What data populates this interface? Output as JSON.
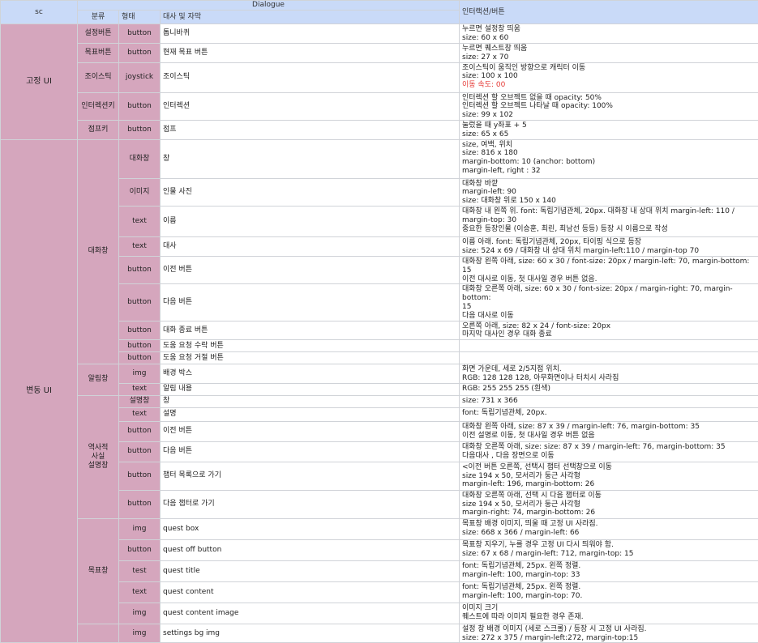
{
  "header": {
    "sc": "sc",
    "dialogue": "Dialogue",
    "interaction": "인터랙션/버튼",
    "col_category": "분류",
    "col_type": "형태",
    "col_desc": "대사 및 자막"
  },
  "groups": {
    "fixed_ui": "고정 UI",
    "variable_ui": "변동 UI"
  },
  "categories": {
    "settings_button": "설정버튼",
    "quest_button": "목표버튼",
    "joystick": "조이스틱",
    "interaction_key": "인터렉션키",
    "jump_key": "점프키",
    "dialogue_window": "대화창",
    "notification_window": "알림창",
    "history_window": "역사적\n사실\n설명창",
    "quest_window": "목표창"
  },
  "rows": [
    {
      "type": "button",
      "desc": "톱니바퀴",
      "note": [
        "누르면 설정창 띄움",
        "size: 60 x 60"
      ]
    },
    {
      "type": "button",
      "desc": "현재 목표 버튼",
      "note": [
        "누르면 퀘스트창 띄움",
        "size: 27 x 70"
      ]
    },
    {
      "type": "joystick",
      "desc": "조이스틱",
      "note": [
        "조이스틱이 움직인 방향으로 캐릭터 이동",
        "size: 100 x 100"
      ],
      "note_red": "이동 속도: 00"
    },
    {
      "type": "button",
      "desc": "인터렉션",
      "note": [
        "인터렉션 할 오브젝트 없을 때    opacity: 50%",
        "인터렉션 할 오브젝트 나타날 때 opacity: 100%",
        "size: 99 x 102"
      ]
    },
    {
      "type": "button",
      "desc": "점프",
      "note": [
        "눌렀을 때 y좌표 + 5",
        "size: 65 x 65"
      ]
    },
    {
      "type": "대화창",
      "desc": "창",
      "note": [
        "size, 여백, 위치",
        "size: 816 x 180",
        "margin-bottom: 10 (anchor: bottom)",
        "margin-left, right : 32"
      ]
    },
    {
      "type": "이미지",
      "desc": "인물 사진",
      "note": [
        "대화창 바깥",
        "margin-left: 90",
        "size: 대화창 위로 150 x 140"
      ]
    },
    {
      "type": "text",
      "desc": "이름",
      "note": [
        "대화창 내 왼쪽 위. font: 독립기념관체, 20px. 대화창 내 상대 위치 margin-left: 110 /",
        "margin-top: 30",
        "중요한 등장인물 (이승훈, 최린, 최남선 등등) 등장 시 이름으로 작성"
      ]
    },
    {
      "type": "text",
      "desc": "대사",
      "note": [
        "이름 아래. font: 독립기념관체, 20px, 타이핑 식으로 등장",
        "size: 524 x 69 / 대화창 내 상대 위치 margin-left:110 / margin-top 70"
      ]
    },
    {
      "type": "button",
      "desc": "이전 버튼",
      "note": [
        "대화창 왼쪽 아래, size: 60 x 30 / font-size: 20px  / margin-left: 70, margin-bottom: 15",
        "이전 대사로 이동, 첫 대사일 경우 버튼 없음."
      ]
    },
    {
      "type": "button",
      "desc": "다음 버튼",
      "note": [
        "대화창 오른쪽 아래, size: 60 x 30 / font-size: 20px  / margin-right: 70, margin-bottom:",
        "15",
        "다음 대사로 이동"
      ]
    },
    {
      "type": "button",
      "desc": "대화 종료 버튼",
      "note": [
        "오른쪽 아래, size: 82 x 24 / font-size: 20px",
        "마지막 대사인 경우 대화 종료"
      ]
    },
    {
      "type": "button",
      "desc": "도움 요청 수락 버튼",
      "note": []
    },
    {
      "type": "button",
      "desc": "도움 요청 거절 버튼",
      "note": []
    },
    {
      "type": "img",
      "desc": "배경 박스",
      "note": [
        "화면 가운데, 세로 2/5지점 위치.",
        "RGB: 128 128 128, 아무화면이나 터치시 사라짐"
      ]
    },
    {
      "type": "text",
      "desc": "알림 내용",
      "note": [
        "RGB: 255 255 255 (흰색)"
      ]
    },
    {
      "type": "설명창",
      "desc": "창",
      "note": [
        "size: 731 x 366"
      ]
    },
    {
      "type": "text",
      "desc": "설명",
      "note": [
        "font: 독립기념관체, 20px."
      ]
    },
    {
      "type": "button",
      "desc": "이전 버튼",
      "note": [
        "대화창 왼쪽 아래, size: 87 x 39  /  margin-left: 76, margin-bottom: 35",
        "이전 설명로 이동, 첫 대사일 경우 버튼 없음"
      ]
    },
    {
      "type": "button",
      "desc": "다음 버튼",
      "note": [
        "대화창 오른쪽 아래, size: size: 87 x 39  / margin-left: 76, margin-bottom: 35",
        "다음대사 , 다음 장면으로 이동"
      ]
    },
    {
      "type": "button",
      "desc": "챕터 목록으로 가기",
      "note": [
        "<이전 버튼 오른쪽, 선택시 챕터 선택창으로 이동",
        "size 194 x 50, 모서리가 둥근 사각형",
        "margin-left: 196, margin-bottom: 26"
      ]
    },
    {
      "type": "button",
      "desc": "다음 챕터로 가기",
      "note": [
        "대화창 오른쪽 아래, 선택 시 다음 챕터로 이동",
        "size 194 x 50, 모서리가 둥근 사각형",
        "margin-right: 74, margin-bottom: 26"
      ]
    },
    {
      "type": "img",
      "desc": "quest box",
      "note": [
        "목표창 배경 이미지, 띄울 때 고정 UI 사라짐.",
        "size: 668 x 366 / margin-left: 66"
      ]
    },
    {
      "type": "button",
      "desc": "quest off button",
      "note": [
        "목표창 지우기, 누를 경우 고정 UI 다시 띄워야 함.",
        "size: 67 x 68 / margin-left: 712, margin-top: 15"
      ]
    },
    {
      "type": "test",
      "desc": "quest title",
      "note": [
        "font: 독립기념관체, 25px. 왼쪽 정렬.",
        "margin-left: 100, margin-top: 33"
      ]
    },
    {
      "type": "text",
      "desc": "quest content",
      "note": [
        "font: 독립기념관체, 25px. 왼쪽 정렬.",
        "margin-left: 100, margin-top: 70."
      ]
    },
    {
      "type": "img",
      "desc": "quest content image",
      "note": [
        "이미지 크기",
        "퀘스트에 따라 이미지 필요한 경우 존재."
      ]
    },
    {
      "type": "img",
      "desc": "settings bg img",
      "note": [
        "설정 창 배경 이미지 (세로 스크롤) / 등장 시 고정 UI 사라짐.",
        "size: 272 x 375 / margin-left:272, margin-top:15"
      ]
    }
  ]
}
